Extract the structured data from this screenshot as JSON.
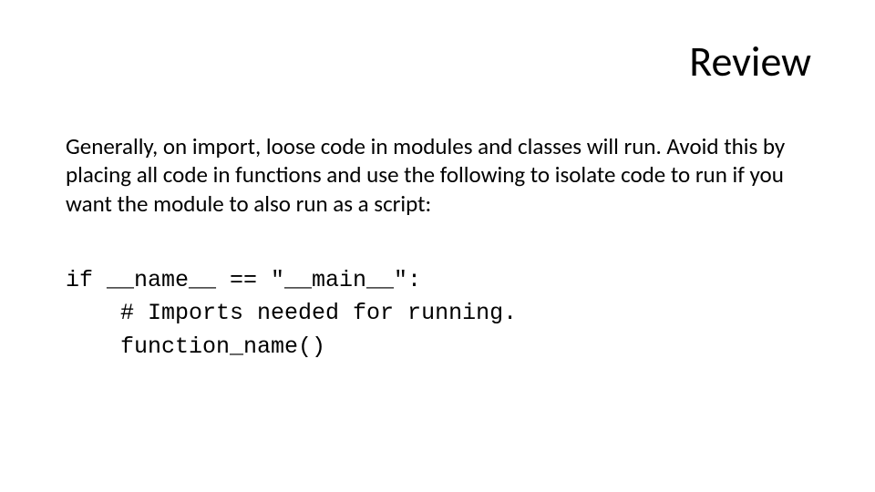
{
  "slide": {
    "title": "Review",
    "paragraph": "Generally, on import, loose code in modules and classes will run. Avoid this by placing all code in functions and use the following to isolate code to run if you want the module to also run as a script:",
    "code": "if __name__ == \"__main__\":\n    # Imports needed for running.\n    function_name()"
  }
}
